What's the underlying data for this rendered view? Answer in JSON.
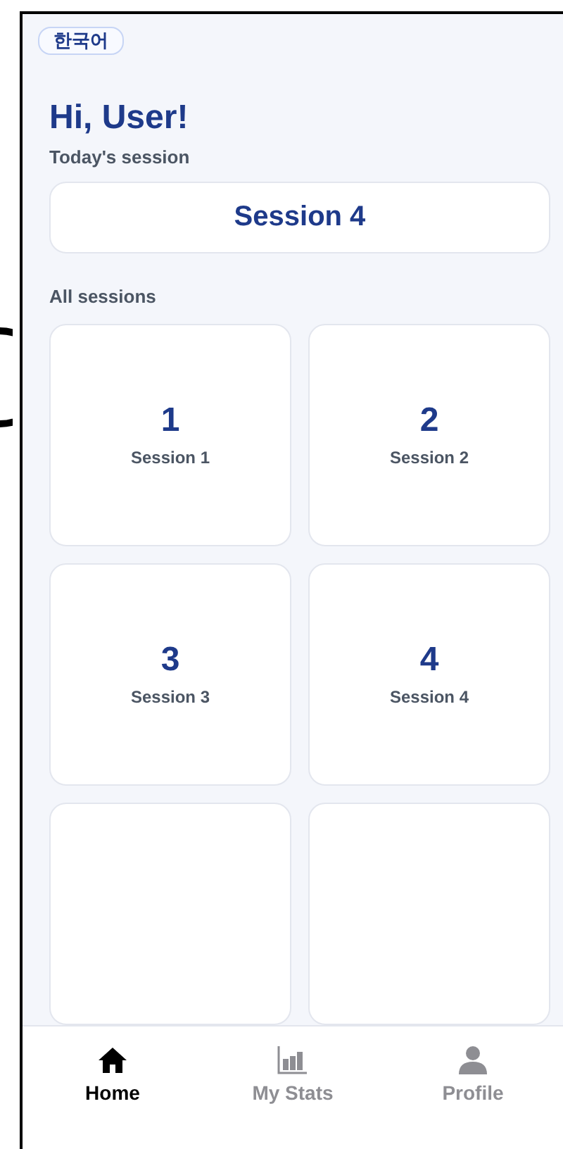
{
  "language_button": "한국어",
  "greeting": "Hi, User!",
  "today": {
    "label": "Today's session",
    "session": "Session 4"
  },
  "all_sessions": {
    "label": "All sessions",
    "items": [
      {
        "number": "1",
        "name": "Session 1"
      },
      {
        "number": "2",
        "name": "Session 2"
      },
      {
        "number": "3",
        "name": "Session 3"
      },
      {
        "number": "4",
        "name": "Session 4"
      }
    ]
  },
  "nav": [
    {
      "kind": "home",
      "label": "Home",
      "selected": true
    },
    {
      "kind": "stats",
      "label": "My Stats",
      "selected": false
    },
    {
      "kind": "profile",
      "label": "Profile",
      "selected": false
    }
  ]
}
